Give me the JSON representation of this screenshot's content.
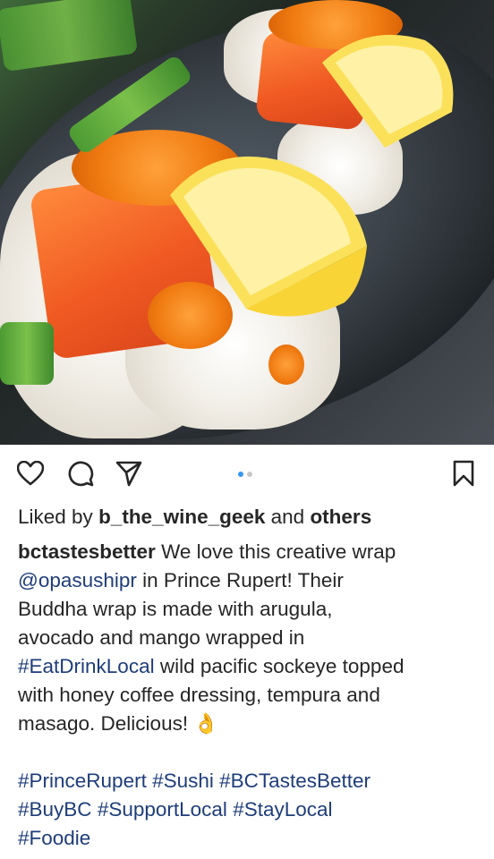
{
  "post": {
    "likes": {
      "prefix": "Liked by ",
      "user": "b_the_wine_geek",
      "middle": " and ",
      "others": "others"
    },
    "caption": {
      "username": "bctastesbetter",
      "line1_text": " We love this creative wrap",
      "line2_mention": "@opasushipr",
      "line2_text": " in Prince Rupert! Their",
      "line3": "Buddha wrap is made with arugula,",
      "line4": "avocado and mango wrapped in",
      "line5_tag": "#EatDrinkLocal",
      "line5_text": " wild pacific sockeye topped",
      "line6": "with honey coffee dressing, tempura and",
      "line7_text": "masago. Delicious! ",
      "line7_emoji": "👌",
      "hashtags_line1": [
        "#PrinceRupert",
        "#Sushi",
        "#BCTastesBetter"
      ],
      "hashtags_line2": [
        "#BuyBC",
        "#SupportLocal",
        "#StayLocal"
      ],
      "hashtags_line3": [
        "#Foodie"
      ]
    },
    "carousel": {
      "total": 2,
      "active": 1
    },
    "icons": {
      "like": "heart-icon",
      "comment": "comment-icon",
      "share": "send-icon",
      "save": "bookmark-icon"
    },
    "colors": {
      "hashtag": "#1e3d7a",
      "active_dot": "#3897f0",
      "inactive_dot": "#c7c7c7"
    }
  }
}
